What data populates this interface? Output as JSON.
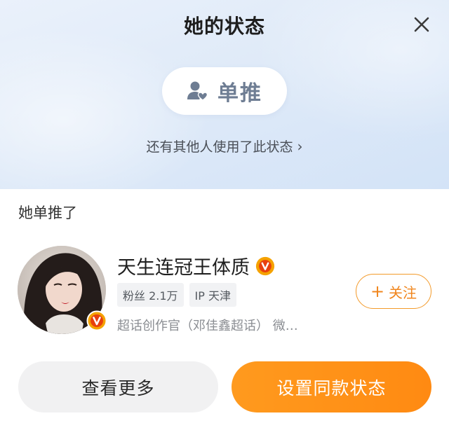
{
  "header": {
    "title": "她的状态",
    "status_label": "单推",
    "others_link": "还有其他人使用了此状态",
    "others_chevron": "›"
  },
  "section": {
    "title": "她单推了"
  },
  "profile": {
    "name": "天生连冠王体质",
    "tags": [
      "粉丝 2.1万",
      "IP 天津"
    ],
    "description": "超话创作官（邓佳鑫超话） 微…",
    "follow_label": "关注",
    "follow_plus": "+"
  },
  "actions": {
    "more_label": "查看更多",
    "set_label": "设置同款状态"
  },
  "colors": {
    "accent_orange": "#ff8f17",
    "verified_badge": "#f5a200",
    "status_icon": "#6e7d93"
  },
  "icons": {
    "close": "close-icon",
    "status": "user-heart-icon",
    "verified": "verified-v-icon"
  }
}
